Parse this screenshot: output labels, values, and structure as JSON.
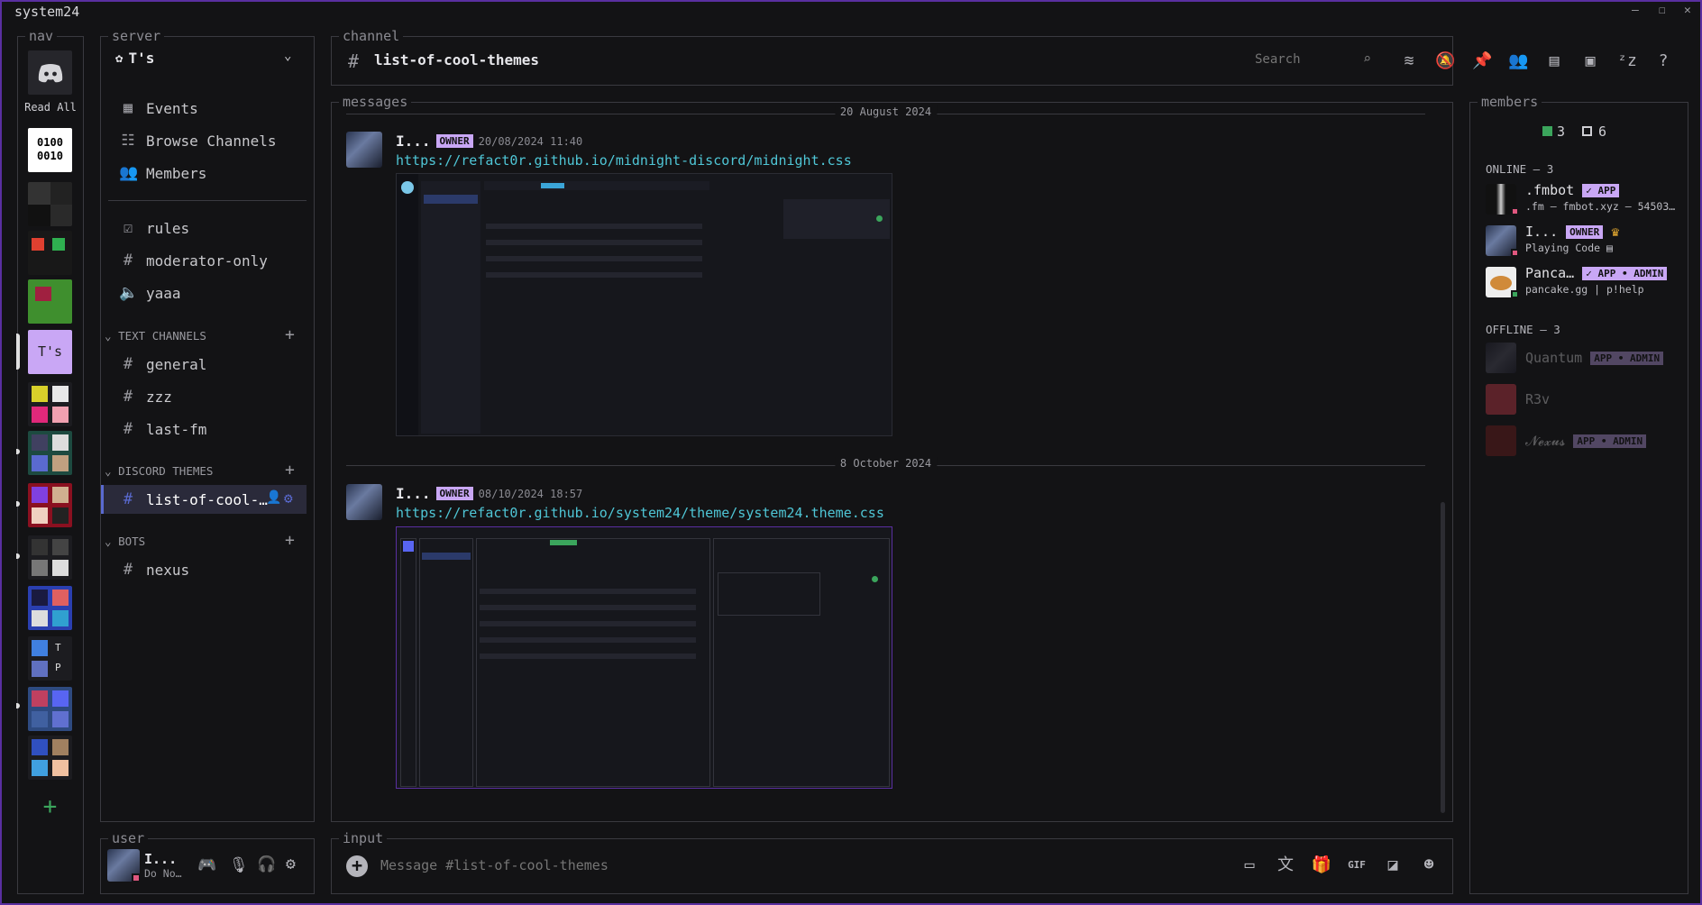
{
  "window": {
    "title": "system24",
    "minimize": "—",
    "maximize": "☐",
    "close": "✕"
  },
  "nav": {
    "title": "nav",
    "read_all": "Read All",
    "server_initials": "T's",
    "add": "+"
  },
  "server": {
    "title": "server",
    "name": "T's",
    "top_items": [
      {
        "label": "Events",
        "icon": "calendar-icon"
      },
      {
        "label": "Browse Channels",
        "icon": "browse-icon"
      },
      {
        "label": "Members",
        "icon": "members-icon"
      }
    ],
    "pinned_channels": [
      {
        "label": "rules",
        "icon": "rules-icon"
      },
      {
        "label": "moderator-only",
        "icon": "hash-lock-icon"
      },
      {
        "label": "yaaa",
        "icon": "speaker-icon"
      }
    ],
    "categories": [
      {
        "name": "TEXT CHANNELS",
        "channels": [
          "general",
          "zzz",
          "last-fm"
        ]
      },
      {
        "name": "DISCORD THEMES",
        "channels": [
          "list-of-cool-…"
        ]
      },
      {
        "name": "BOTS",
        "channels": [
          "nexus"
        ]
      }
    ]
  },
  "channel": {
    "title": "channel",
    "name": "list-of-cool-themes",
    "search_placeholder": "Search"
  },
  "messages": {
    "title": "messages",
    "items": [
      {
        "date": "20 August 2024",
        "author": "I...",
        "badge": "OWNER",
        "timestamp": "20/08/2024 11:40",
        "link": "https://refact0r.github.io/midnight-discord/midnight.css"
      },
      {
        "date": "8 October 2024",
        "author": "I...",
        "badge": "OWNER",
        "timestamp": "08/10/2024 18:57",
        "link": "https://refact0r.github.io/system24/theme/system24.theme.css"
      }
    ]
  },
  "members": {
    "title": "members",
    "online_count": "3",
    "total_count": "6",
    "online_header": "ONLINE — 3",
    "offline_header": "OFFLINE — 3",
    "online": [
      {
        "name": ".fmbot",
        "badge": "✓ APP",
        "sub": ".fm — fmbot.xyz — 54503…"
      },
      {
        "name": "I...",
        "badge": "OWNER",
        "sub": "Playing Code"
      },
      {
        "name": "Panca…",
        "badge": "✓ APP • ADMIN",
        "sub": "pancake.gg | p!help"
      }
    ],
    "offline": [
      {
        "name": "Quantum",
        "badge": "APP • ADMIN"
      },
      {
        "name": "R3v",
        "badge": ""
      },
      {
        "name": "𝓝𝓮𝔁𝓾𝓼",
        "badge": "APP • ADMIN"
      }
    ]
  },
  "user": {
    "title": "user",
    "name": "I...",
    "status": "Do No…"
  },
  "input": {
    "title": "input",
    "placeholder": "Message #list-of-cool-themes",
    "gif": "GIF"
  },
  "colors": {
    "accent": "#c9a7f5",
    "link": "#4fc6d6",
    "online": "#3ba55c",
    "dnd": "#e0577f",
    "border": "#5a2fa0"
  }
}
